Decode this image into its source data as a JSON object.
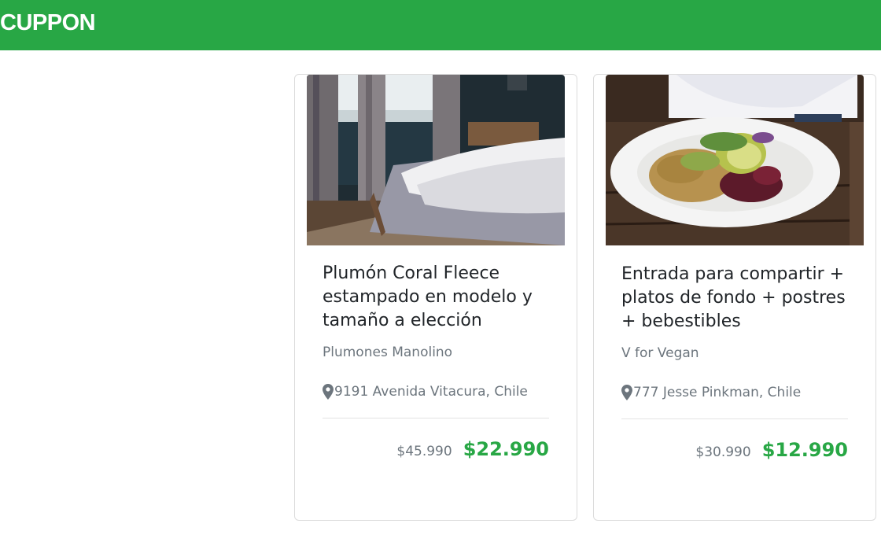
{
  "navbar": {
    "brand": "CUPPON"
  },
  "colors": {
    "brand_green": "#28a745",
    "muted_text": "#6c757d",
    "title_text": "#212529"
  },
  "deals": [
    {
      "image": "bedroom-photo",
      "title": "Plumón Coral Fleece estampado en modelo y tamaño a elección",
      "merchant": "Plumones Manolino",
      "location": "9191 Avenida Vitacura, Chile",
      "location_icon": "map-pin-icon",
      "old_price": "$45.990",
      "new_price": "$22.990"
    },
    {
      "image": "vegan-salad-photo",
      "title": "Entrada para compartir + platos de fondo + postres + bebestibles",
      "merchant": "V for Vegan",
      "location": "777 Jesse Pinkman, Chile",
      "location_icon": "map-pin-icon",
      "old_price": "$30.990",
      "new_price": "$12.990"
    }
  ]
}
